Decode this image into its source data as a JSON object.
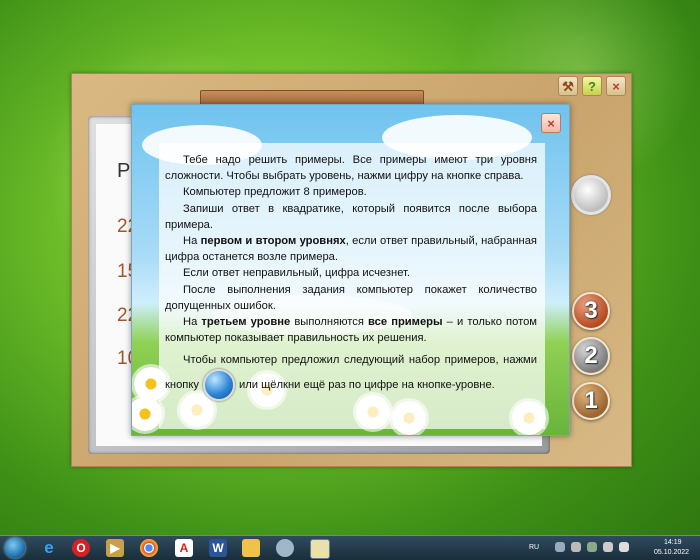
{
  "game": {
    "board_title": "Р",
    "board_rows": [
      "22",
      "15",
      "22",
      "10"
    ],
    "level_buttons": [
      "3",
      "2",
      "1"
    ]
  },
  "dialog": {
    "close_label": "×",
    "paragraphs": {
      "p1": "Тебе надо решить примеры. Все примеры имеют три уровня сложности. Чтобы выбрать уровень, нажми цифру на кнопке справа.",
      "p2": "Компьютер предложит 8 примеров.",
      "p3": "Запиши ответ в квадратике, который появится после выбора примера.",
      "p4_pre": "На ",
      "p4_bold": "первом и втором уровнях",
      "p4_post": ", если ответ правильный, набранная цифра останется возле примера.",
      "p5": "Если ответ неправильный, цифра исчезнет.",
      "p6": "После выполнения задания компьютер покажет количество допущенных ошибок.",
      "p7_pre": "На ",
      "p7_bold": "третьем уровне",
      "p7_mid": " выполняются ",
      "p7_bold2": "все примеры",
      "p7_post": " – и только потом компьютер показывает правильность их решения.",
      "p8_pre": "Чтобы компьютер предложил следующий набор примеров, нажми кнопку",
      "p8_post": "или щёлкни ещё раз по цифре на кнопке-уровне."
    }
  },
  "taskbar": {
    "lang": "RU",
    "time": "14:19",
    "date": "05.10.2022"
  },
  "icons": [
    "start-orb",
    "ie-icon",
    "opera-icon",
    "media-player-icon",
    "chrome-icon",
    "acrobat-icon",
    "word-icon",
    "explorer-icon",
    "paint-icon",
    "app-icon"
  ]
}
